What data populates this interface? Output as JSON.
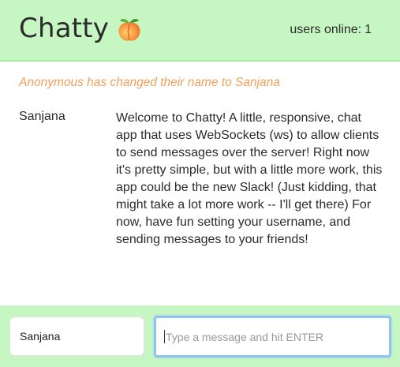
{
  "header": {
    "app_name": "Chatty",
    "logo_icon": "peach-emoji-icon",
    "online_label": "users online:",
    "online_count": "1"
  },
  "feed": {
    "system_message": "Anonymous has changed their name to Sanjana",
    "messages": [
      {
        "user": "Sanjana",
        "text": "Welcome to Chatty! A little, responsive, chat app that uses WebSockets (ws) to allow clients to send messages over the server! Right now it's pretty simple, but with a little more work, this app could be the new Slack! (Just kidding, that might take a lot more work -- I'll get there) For now, have fun setting your username, and sending messages to your friends!"
      }
    ]
  },
  "footer": {
    "username_value": "Sanjana",
    "message_placeholder": "Type a message and hit ENTER"
  },
  "colors": {
    "bar_background": "#c6f7c2",
    "system_message": "#f0a15a",
    "focus_ring": "#8fc3f2"
  }
}
